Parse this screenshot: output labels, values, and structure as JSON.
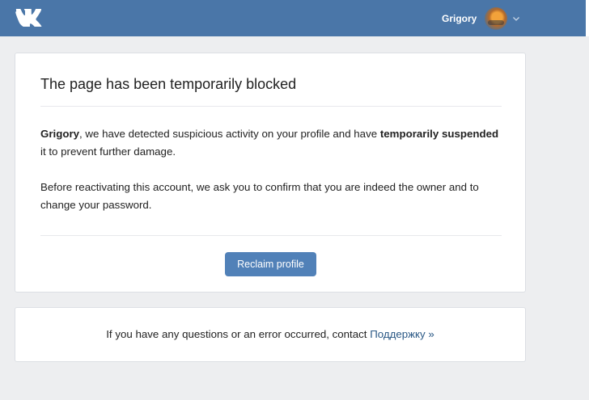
{
  "header": {
    "user_name": "Grigory",
    "brand_color": "#4a76a8"
  },
  "main": {
    "title": "The page has been temporarily blocked",
    "paragraph1": {
      "name": "Grigory",
      "text_a": ", we have detected suspicious activity on your profile and have ",
      "emphasis": "temporarily suspended",
      "text_b": " it to prevent further damage."
    },
    "paragraph2": "Before reactivating this account, we ask you to confirm that you are indeed the owner and to change your password.",
    "button_label": "Reclaim profile",
    "button_color": "#5181b8"
  },
  "footer": {
    "text": "If you have any questions or an error occurred, contact ",
    "link_label": "Поддержку »",
    "link_color": "#2a5885"
  },
  "icons": {
    "logo": "vk-logo-icon",
    "avatar": "user-avatar",
    "chevron": "chevron-down-icon"
  }
}
